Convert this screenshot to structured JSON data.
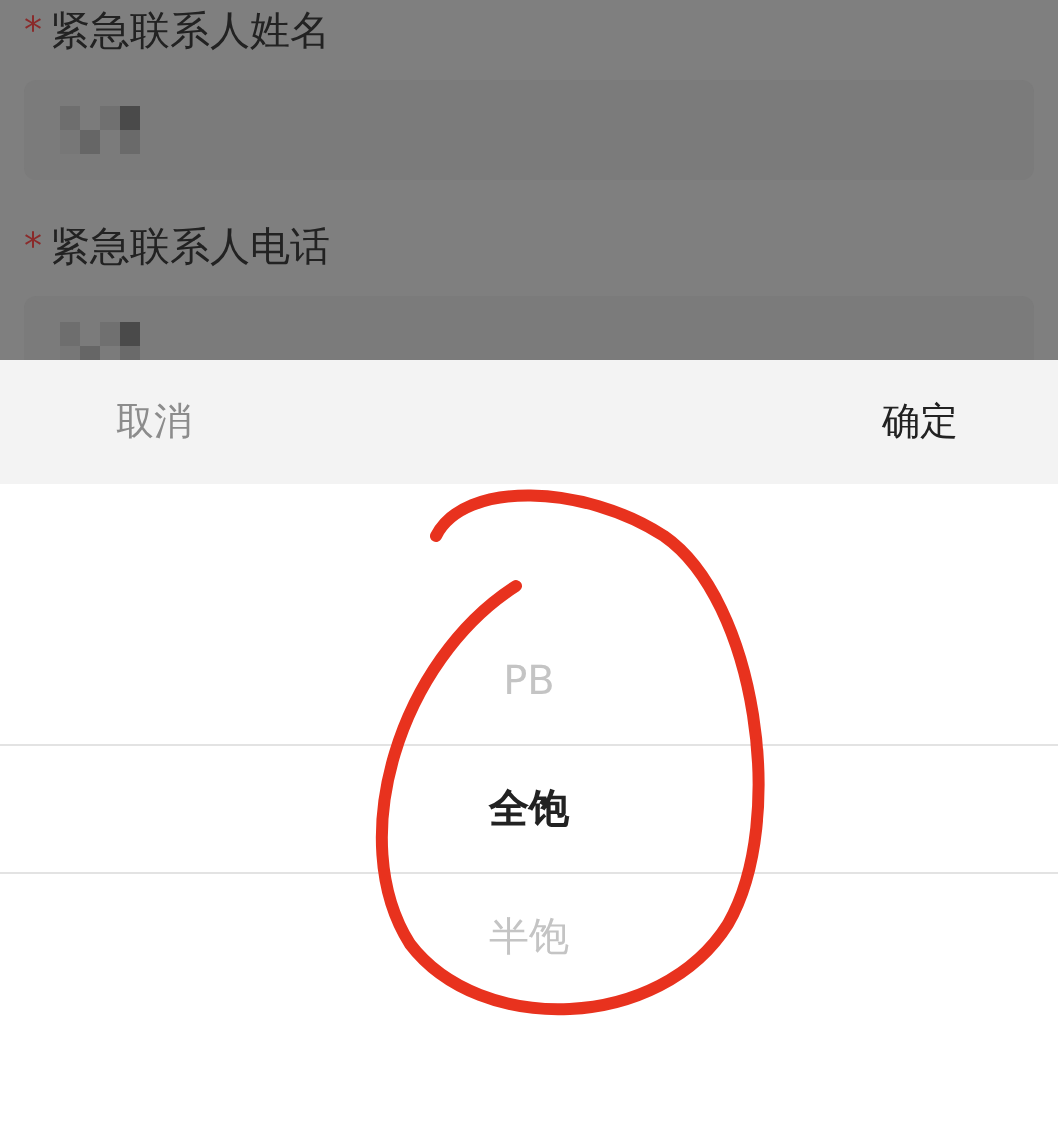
{
  "form": {
    "fields": [
      {
        "mark": "*",
        "label": "紧急联系人姓名"
      },
      {
        "mark": "*",
        "label": "紧急联系人电话"
      }
    ]
  },
  "picker": {
    "cancel": "取消",
    "confirm": "确定",
    "options": [
      {
        "label": "PB",
        "selected": false
      },
      {
        "label": "全饱",
        "selected": true
      },
      {
        "label": "半饱",
        "selected": false
      }
    ]
  },
  "annotation": {
    "kind": "circle"
  }
}
